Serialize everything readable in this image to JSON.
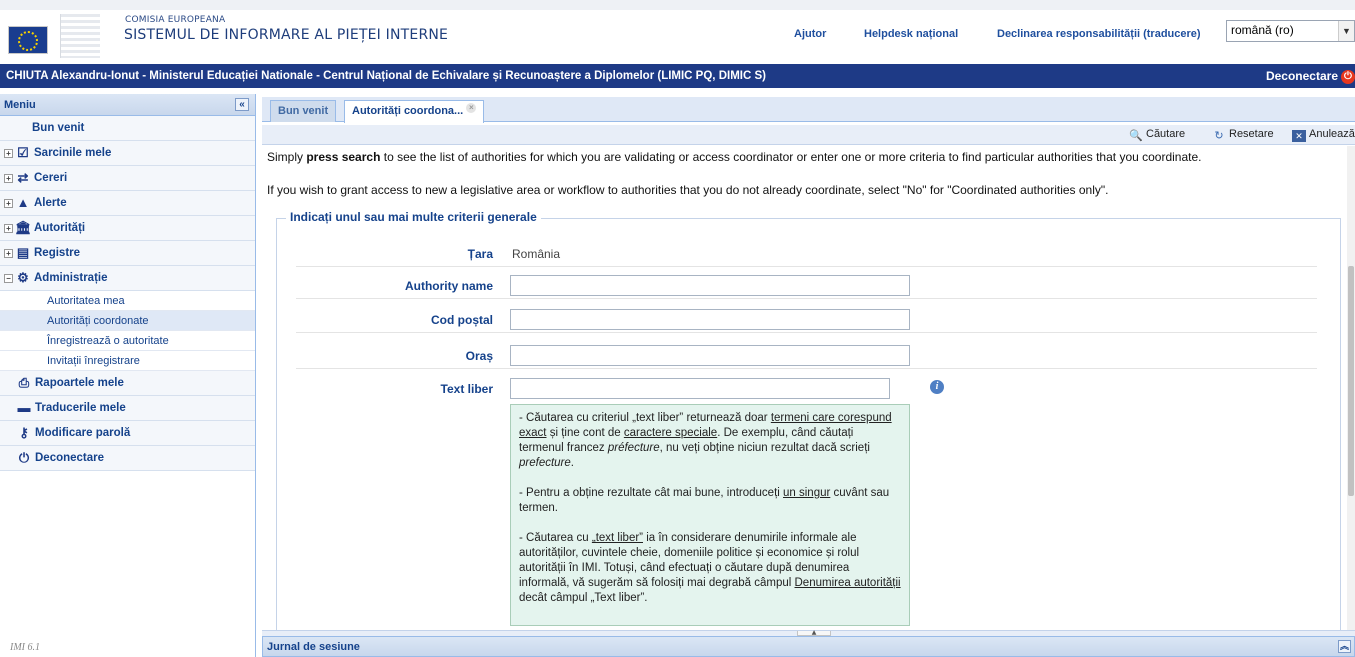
{
  "header": {
    "org_name": "COMISIA EUROPEANA",
    "system_name": "SISTEMUL DE INFORMARE AL PIEȚEI INTERNE",
    "links": {
      "help": "Ajutor",
      "helpdesk": "Helpdesk național",
      "disclaimer": "Declinarea responsabilității (traducere)"
    },
    "language": "română (ro)"
  },
  "userbar": {
    "user_text": "CHIUTA Alexandru-Ionut - Ministerul Educației Nationale - Centrul Național de Echivalare și Recunoaștere a Diplomelor (LIMIC PQ, DIMIC S)",
    "logout": "Deconectare"
  },
  "sidebar": {
    "title": "Meniu",
    "items": {
      "welcome": "Bun venit",
      "tasks": "Sarcinile mele",
      "requests": "Cereri",
      "alerts": "Alerte",
      "authorities": "Autorități",
      "registers": "Registre",
      "admin": "Administrație",
      "reports": "Rapoartele mele",
      "translations": "Traducerile mele",
      "password": "Modificare parolă",
      "logout": "Deconectare"
    },
    "admin_sub": {
      "my_authority": "Autoritatea mea",
      "coordinated": "Autorități coordonate",
      "register": "Înregistrează o autoritate",
      "invitations": "Invitații înregistrare"
    },
    "version": "IMI 6.1"
  },
  "tabs": {
    "welcome": "Bun venit",
    "coordinated": "Autorități coordona..."
  },
  "toolbar": {
    "search": "Căutare",
    "reset": "Resetare",
    "cancel": "Anulează"
  },
  "content": {
    "intro1_pre": "Simply ",
    "intro1_bold": "press search",
    "intro1_post": " to see the list of authorities for which you are validating or access coordinator or enter one or more criteria to find particular authorities that you coordinate.",
    "intro2": "If you wish to grant access to new a legislative area or workflow to authorities that you do not already coordinate, select \"No\" for \"Coordinated authorities only\".",
    "legend": "Indicați unul sau mai multe criterii generale",
    "fields": {
      "country_label": "Țara",
      "country_value": "România",
      "authority_label": "Authority name",
      "postal_label": "Cod poștal",
      "city_label": "Oraș",
      "freetext_label": "Text liber"
    },
    "help": {
      "p1_a": "- Căutarea cu criteriul „text liber” returnează doar ",
      "p1_u1": "termeni care corespund exact",
      "p1_b": " și ține cont de ",
      "p1_u2": "caractere speciale",
      "p1_c": ". De exemplu, când căutați termenul francez ",
      "p1_i1": "préfecture",
      "p1_d": ", nu veți obține niciun rezultat dacă scrieți ",
      "p1_i2": "prefecture",
      "p1_e": ".",
      "p2_a": "- Pentru a obține rezultate cât mai bune, introduceți ",
      "p2_u": "un singur",
      "p2_b": " cuvânt sau termen.",
      "p3_a": "- Căutarea cu ",
      "p3_u1": "„text liber”",
      "p3_b": " ia în considerare denumirile informale ale autorităților, cuvintele cheie, domeniile politice și economice și rolul autorității în IMI. Totuși, când efectuați o căutare după denumirea informală, vă sugerăm să folosiți mai degrabă câmpul ",
      "p3_u2": "Denumirea autorității",
      "p3_c": " decât câmpul „Text liber”."
    }
  },
  "journal": {
    "title": "Jurnal de sesiune"
  }
}
